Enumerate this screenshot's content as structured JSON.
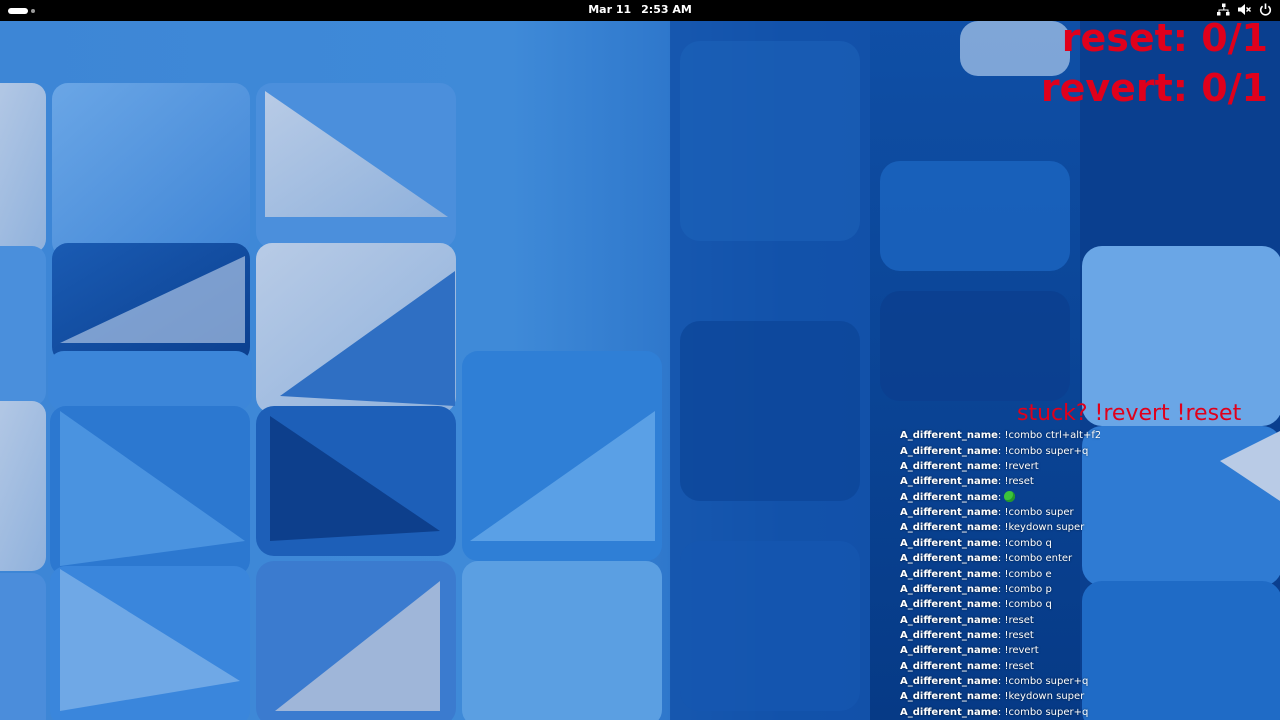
{
  "topbar": {
    "clock_date": "Mar 11",
    "clock_time": "2:53 AM",
    "icons": [
      "workspace-indicator-icon",
      "network-icon",
      "volume-muted-icon",
      "power-icon"
    ]
  },
  "counters": {
    "reset": "reset: 0/1",
    "revert": "revert: 0/1",
    "color": "#e0001b"
  },
  "hint": "stuck? !revert !reset",
  "chat": [
    {
      "user": "A_different_name",
      "message": "!combo ctrl+alt+f2"
    },
    {
      "user": "A_different_name",
      "message": "!combo super+q"
    },
    {
      "user": "A_different_name",
      "message": "!revert"
    },
    {
      "user": "A_different_name",
      "message": "!reset"
    },
    {
      "user": "A_different_name",
      "message": "",
      "emote": "green-blob-emote"
    },
    {
      "user": "A_different_name",
      "message": "!combo super"
    },
    {
      "user": "A_different_name",
      "message": "!keydown super"
    },
    {
      "user": "A_different_name",
      "message": "!combo q"
    },
    {
      "user": "A_different_name",
      "message": "!combo enter"
    },
    {
      "user": "A_different_name",
      "message": "!combo e"
    },
    {
      "user": "A_different_name",
      "message": "!combo p"
    },
    {
      "user": "A_different_name",
      "message": "!combo q"
    },
    {
      "user": "A_different_name",
      "message": "!reset"
    },
    {
      "user": "A_different_name",
      "message": "!reset"
    },
    {
      "user": "A_different_name",
      "message": "!revert"
    },
    {
      "user": "A_different_name",
      "message": "!reset"
    },
    {
      "user": "A_different_name",
      "message": "!combo super+q"
    },
    {
      "user": "A_different_name",
      "message": "!keydown super"
    },
    {
      "user": "A_different_name",
      "message": "!combo super+q"
    }
  ]
}
